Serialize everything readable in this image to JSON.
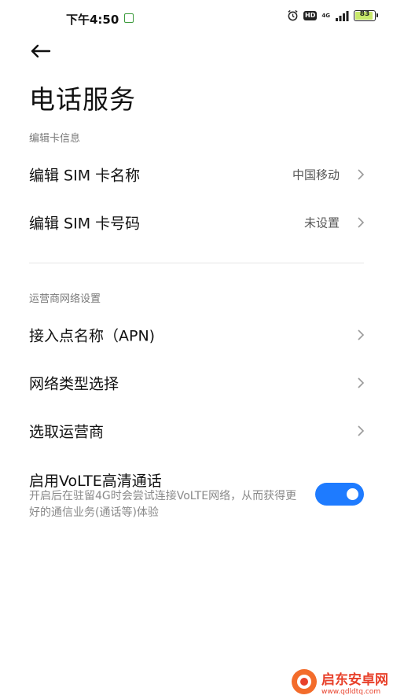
{
  "status_bar": {
    "time": "下午4:50",
    "net_type": "4G",
    "hd": "HD",
    "battery_level": "83",
    "battery_fraction": 0.83
  },
  "page": {
    "title": "电话服务"
  },
  "section_card": {
    "header": "编辑卡信息",
    "items": [
      {
        "label": "编辑 SIM 卡名称",
        "value": "中国移动"
      },
      {
        "label": "编辑 SIM 卡号码",
        "value": "未设置"
      }
    ]
  },
  "section_carrier": {
    "header": "运营商网络设置",
    "items": [
      {
        "label": "接入点名称（APN)"
      },
      {
        "label": "网络类型选择"
      },
      {
        "label": "选取运营商"
      }
    ]
  },
  "volte": {
    "title": "启用VoLTE高清通话",
    "description": "开启后在驻留4G时会尝试连接VoLTE网络，从而获得更好的通信业务(通话等)体验",
    "enabled": true
  },
  "colors": {
    "accent": "#1e7bff",
    "watermark": "#e8402a"
  },
  "watermark": {
    "name": "启东安卓网",
    "url": "www.qdldtq.com"
  },
  "icons": [
    "back-arrow-icon",
    "chevron-right-icon",
    "alarm-icon",
    "signal-icon",
    "battery-icon"
  ]
}
